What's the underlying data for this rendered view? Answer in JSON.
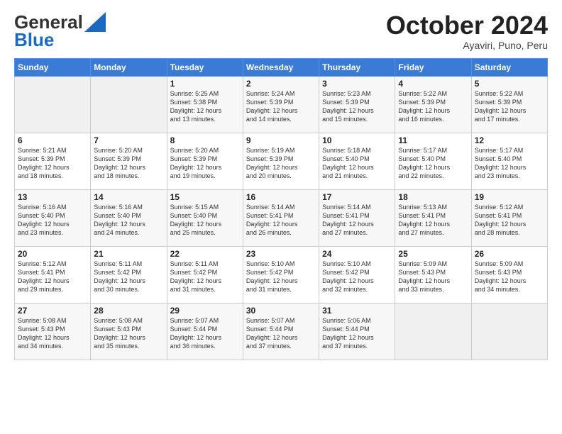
{
  "header": {
    "logo_line1": "General",
    "logo_line2": "Blue",
    "month": "October 2024",
    "location": "Ayaviri, Puno, Peru"
  },
  "days_of_week": [
    "Sunday",
    "Monday",
    "Tuesday",
    "Wednesday",
    "Thursday",
    "Friday",
    "Saturday"
  ],
  "weeks": [
    [
      {
        "day": "",
        "info": ""
      },
      {
        "day": "",
        "info": ""
      },
      {
        "day": "1",
        "info": "Sunrise: 5:25 AM\nSunset: 5:38 PM\nDaylight: 12 hours\nand 13 minutes."
      },
      {
        "day": "2",
        "info": "Sunrise: 5:24 AM\nSunset: 5:39 PM\nDaylight: 12 hours\nand 14 minutes."
      },
      {
        "day": "3",
        "info": "Sunrise: 5:23 AM\nSunset: 5:39 PM\nDaylight: 12 hours\nand 15 minutes."
      },
      {
        "day": "4",
        "info": "Sunrise: 5:22 AM\nSunset: 5:39 PM\nDaylight: 12 hours\nand 16 minutes."
      },
      {
        "day": "5",
        "info": "Sunrise: 5:22 AM\nSunset: 5:39 PM\nDaylight: 12 hours\nand 17 minutes."
      }
    ],
    [
      {
        "day": "6",
        "info": "Sunrise: 5:21 AM\nSunset: 5:39 PM\nDaylight: 12 hours\nand 18 minutes."
      },
      {
        "day": "7",
        "info": "Sunrise: 5:20 AM\nSunset: 5:39 PM\nDaylight: 12 hours\nand 18 minutes."
      },
      {
        "day": "8",
        "info": "Sunrise: 5:20 AM\nSunset: 5:39 PM\nDaylight: 12 hours\nand 19 minutes."
      },
      {
        "day": "9",
        "info": "Sunrise: 5:19 AM\nSunset: 5:39 PM\nDaylight: 12 hours\nand 20 minutes."
      },
      {
        "day": "10",
        "info": "Sunrise: 5:18 AM\nSunset: 5:40 PM\nDaylight: 12 hours\nand 21 minutes."
      },
      {
        "day": "11",
        "info": "Sunrise: 5:17 AM\nSunset: 5:40 PM\nDaylight: 12 hours\nand 22 minutes."
      },
      {
        "day": "12",
        "info": "Sunrise: 5:17 AM\nSunset: 5:40 PM\nDaylight: 12 hours\nand 23 minutes."
      }
    ],
    [
      {
        "day": "13",
        "info": "Sunrise: 5:16 AM\nSunset: 5:40 PM\nDaylight: 12 hours\nand 23 minutes."
      },
      {
        "day": "14",
        "info": "Sunrise: 5:16 AM\nSunset: 5:40 PM\nDaylight: 12 hours\nand 24 minutes."
      },
      {
        "day": "15",
        "info": "Sunrise: 5:15 AM\nSunset: 5:40 PM\nDaylight: 12 hours\nand 25 minutes."
      },
      {
        "day": "16",
        "info": "Sunrise: 5:14 AM\nSunset: 5:41 PM\nDaylight: 12 hours\nand 26 minutes."
      },
      {
        "day": "17",
        "info": "Sunrise: 5:14 AM\nSunset: 5:41 PM\nDaylight: 12 hours\nand 27 minutes."
      },
      {
        "day": "18",
        "info": "Sunrise: 5:13 AM\nSunset: 5:41 PM\nDaylight: 12 hours\nand 27 minutes."
      },
      {
        "day": "19",
        "info": "Sunrise: 5:12 AM\nSunset: 5:41 PM\nDaylight: 12 hours\nand 28 minutes."
      }
    ],
    [
      {
        "day": "20",
        "info": "Sunrise: 5:12 AM\nSunset: 5:41 PM\nDaylight: 12 hours\nand 29 minutes."
      },
      {
        "day": "21",
        "info": "Sunrise: 5:11 AM\nSunset: 5:42 PM\nDaylight: 12 hours\nand 30 minutes."
      },
      {
        "day": "22",
        "info": "Sunrise: 5:11 AM\nSunset: 5:42 PM\nDaylight: 12 hours\nand 31 minutes."
      },
      {
        "day": "23",
        "info": "Sunrise: 5:10 AM\nSunset: 5:42 PM\nDaylight: 12 hours\nand 31 minutes."
      },
      {
        "day": "24",
        "info": "Sunrise: 5:10 AM\nSunset: 5:42 PM\nDaylight: 12 hours\nand 32 minutes."
      },
      {
        "day": "25",
        "info": "Sunrise: 5:09 AM\nSunset: 5:43 PM\nDaylight: 12 hours\nand 33 minutes."
      },
      {
        "day": "26",
        "info": "Sunrise: 5:09 AM\nSunset: 5:43 PM\nDaylight: 12 hours\nand 34 minutes."
      }
    ],
    [
      {
        "day": "27",
        "info": "Sunrise: 5:08 AM\nSunset: 5:43 PM\nDaylight: 12 hours\nand 34 minutes."
      },
      {
        "day": "28",
        "info": "Sunrise: 5:08 AM\nSunset: 5:43 PM\nDaylight: 12 hours\nand 35 minutes."
      },
      {
        "day": "29",
        "info": "Sunrise: 5:07 AM\nSunset: 5:44 PM\nDaylight: 12 hours\nand 36 minutes."
      },
      {
        "day": "30",
        "info": "Sunrise: 5:07 AM\nSunset: 5:44 PM\nDaylight: 12 hours\nand 37 minutes."
      },
      {
        "day": "31",
        "info": "Sunrise: 5:06 AM\nSunset: 5:44 PM\nDaylight: 12 hours\nand 37 minutes."
      },
      {
        "day": "",
        "info": ""
      },
      {
        "day": "",
        "info": ""
      }
    ]
  ]
}
